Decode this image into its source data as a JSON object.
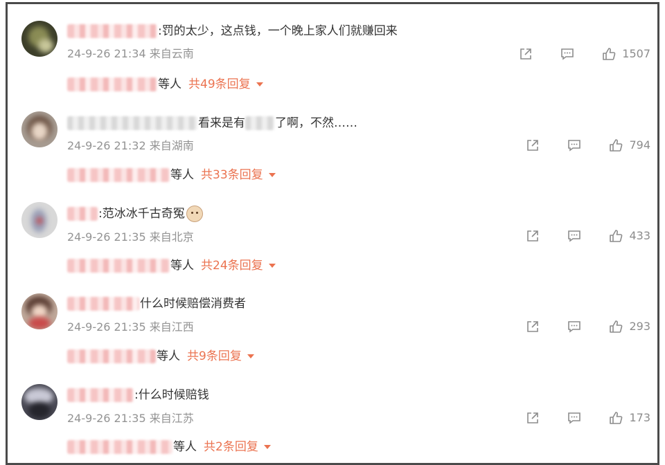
{
  "comments": [
    {
      "text": ":罚的太少，这点钱，一个晚上家人们就赚回来",
      "time": "24-9-26 21:34",
      "location": "来自云南",
      "likes": "1507",
      "replies_who": "等人",
      "replies_count": "共49条回复"
    },
    {
      "text": "看来是有",
      "text2": "了啊，不然……",
      "time": "24-9-26 21:32",
      "location": "来自湖南",
      "likes": "794",
      "replies_who": "等人",
      "replies_count": "共33条回复"
    },
    {
      "text": ":范冰冰千古奇冤",
      "emoji": "cat-face-emoji",
      "time": "24-9-26 21:35",
      "location": "来自北京",
      "likes": "433",
      "replies_who": "等人",
      "replies_count": "共24条回复"
    },
    {
      "text": "什么时候赔偿消费者",
      "time": "24-9-26 21:35",
      "location": "来自江西",
      "likes": "293",
      "replies_who": "等人",
      "replies_count": "共9条回复"
    },
    {
      "text": ":什么时候赔钱",
      "time": "24-9-26 21:35",
      "location": "来自江苏",
      "likes": "173",
      "replies_who": "等人",
      "replies_count": "共2条回复"
    }
  ],
  "icons": {
    "share": "share-icon",
    "comment": "comment-icon",
    "like": "like-icon",
    "expand": "caret-down-icon"
  },
  "colors": {
    "accent": "#eb7350",
    "meta": "#939393",
    "text": "#333333"
  }
}
